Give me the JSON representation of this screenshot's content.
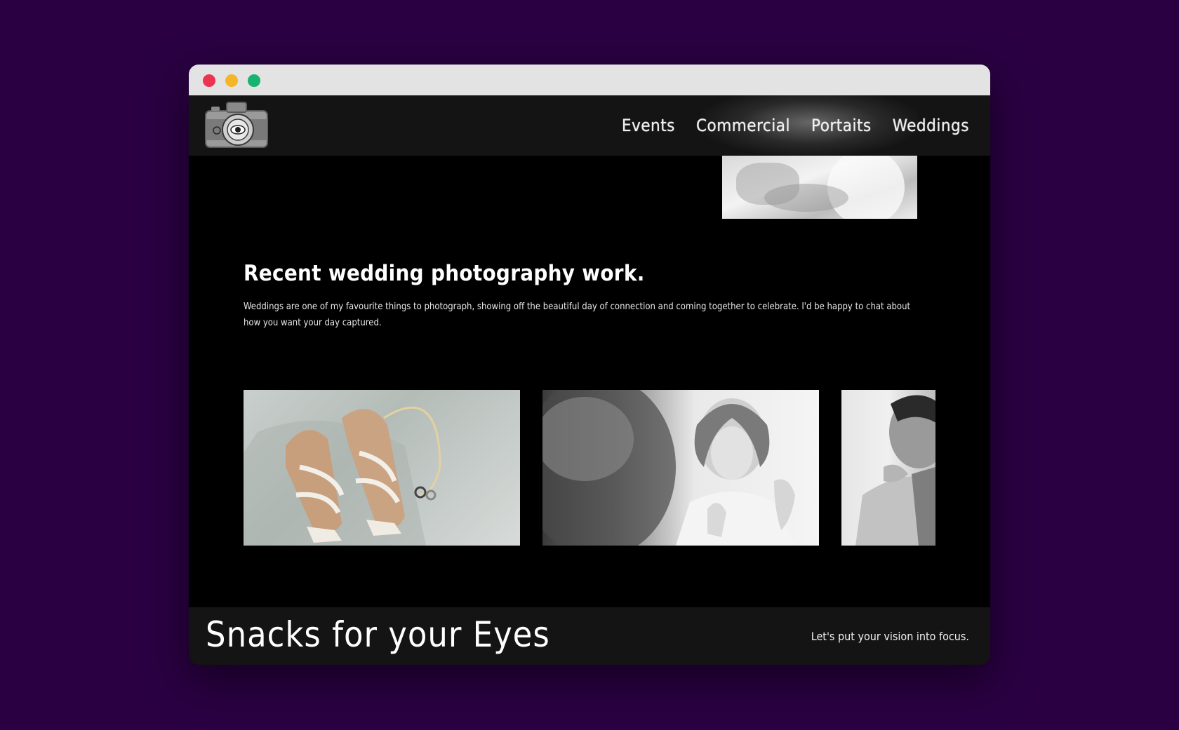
{
  "window": {
    "controls": [
      "close",
      "minimize",
      "maximize"
    ]
  },
  "header": {
    "logo_icon": "camera-logo-icon",
    "nav": [
      {
        "label": "Events"
      },
      {
        "label": "Commercial"
      },
      {
        "label": "Portaits"
      },
      {
        "label": "Weddings"
      }
    ]
  },
  "main": {
    "heading": "Recent wedding photography work.",
    "description": "Weddings are one of my favourite things to photograph, showing off the beautiful day of connection and coming together to celebrate. I'd be happy to chat about how you want your day captured.",
    "gallery": [
      {
        "alt": "wedding-shoes-photo"
      },
      {
        "alt": "bride-portrait-photo"
      },
      {
        "alt": "groom-laughing-photo"
      }
    ]
  },
  "footer": {
    "brand": "Snacks for your Eyes",
    "tagline": "Let's put your vision into focus."
  },
  "colors": {
    "background": "#2a0042",
    "window_bg": "#000000",
    "navbar_bg": "#141414",
    "close": "#ec3350",
    "minimize": "#f5b524",
    "maximize": "#17b370"
  }
}
